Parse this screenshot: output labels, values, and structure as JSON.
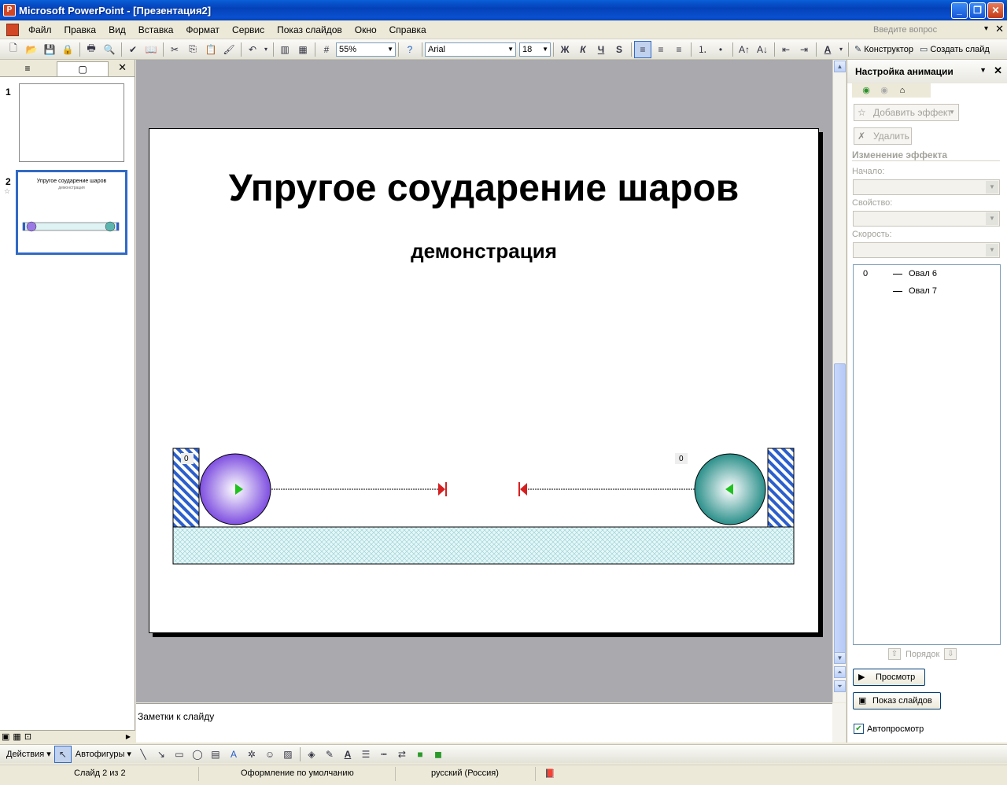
{
  "window": {
    "title": "Microsoft PowerPoint - [Презентация2]",
    "app_icon": "powerpoint-icon",
    "minimize": "_",
    "restore": "❐",
    "close": "✕"
  },
  "menu": {
    "items": [
      "Файл",
      "Правка",
      "Вид",
      "Вставка",
      "Формат",
      "Сервис",
      "Показ слайдов",
      "Окно",
      "Справка"
    ],
    "ask_placeholder": "Введите вопрос",
    "close": "✕"
  },
  "toolbar": {
    "zoom": "55%",
    "font": "Arial",
    "font_size": "18",
    "bold": "Ж",
    "italic": "К",
    "underline": "Ч",
    "shadow": "S",
    "designer": "Конструктор",
    "new_slide": "Создать слайд"
  },
  "left_panel": {
    "tab_outline": "≡",
    "tab_slides": "▢",
    "close": "✕",
    "slides": [
      {
        "number": "1",
        "title": ""
      },
      {
        "number": "2",
        "title": "Упругое соударение шаров",
        "subtitle": "демонстрация"
      }
    ]
  },
  "slide": {
    "title": "Упругое соударение шаров",
    "subtitle": "демонстрация",
    "left_counter": "0",
    "right_counter": "0",
    "colors": {
      "left_ball": "#7e4ee0",
      "right_ball": "#2a8f8a",
      "ground": "#bfe6ea",
      "wall": "#2b5fcc"
    }
  },
  "notes": {
    "placeholder": "Заметки к слайду"
  },
  "task_pane": {
    "title": "Настройка анимации",
    "add_effect": "Добавить эффект",
    "remove": "Удалить",
    "change_effect": "Изменение эффекта",
    "start_label": "Начало:",
    "property_label": "Свойство:",
    "speed_label": "Скорость:",
    "list": [
      {
        "index": "0",
        "name": "Овал 6"
      },
      {
        "index": "",
        "name": "Овал 7"
      }
    ],
    "order_label": "Порядок",
    "preview": "Просмотр",
    "slideshow": "Показ слайдов",
    "autopreview": "Автопросмотр"
  },
  "draw_toolbar": {
    "actions": "Действия",
    "autoshapes": "Автофигуры"
  },
  "status": {
    "slide": "Слайд 2 из 2",
    "design": "Оформление по умолчанию",
    "language": "русский (Россия)"
  }
}
